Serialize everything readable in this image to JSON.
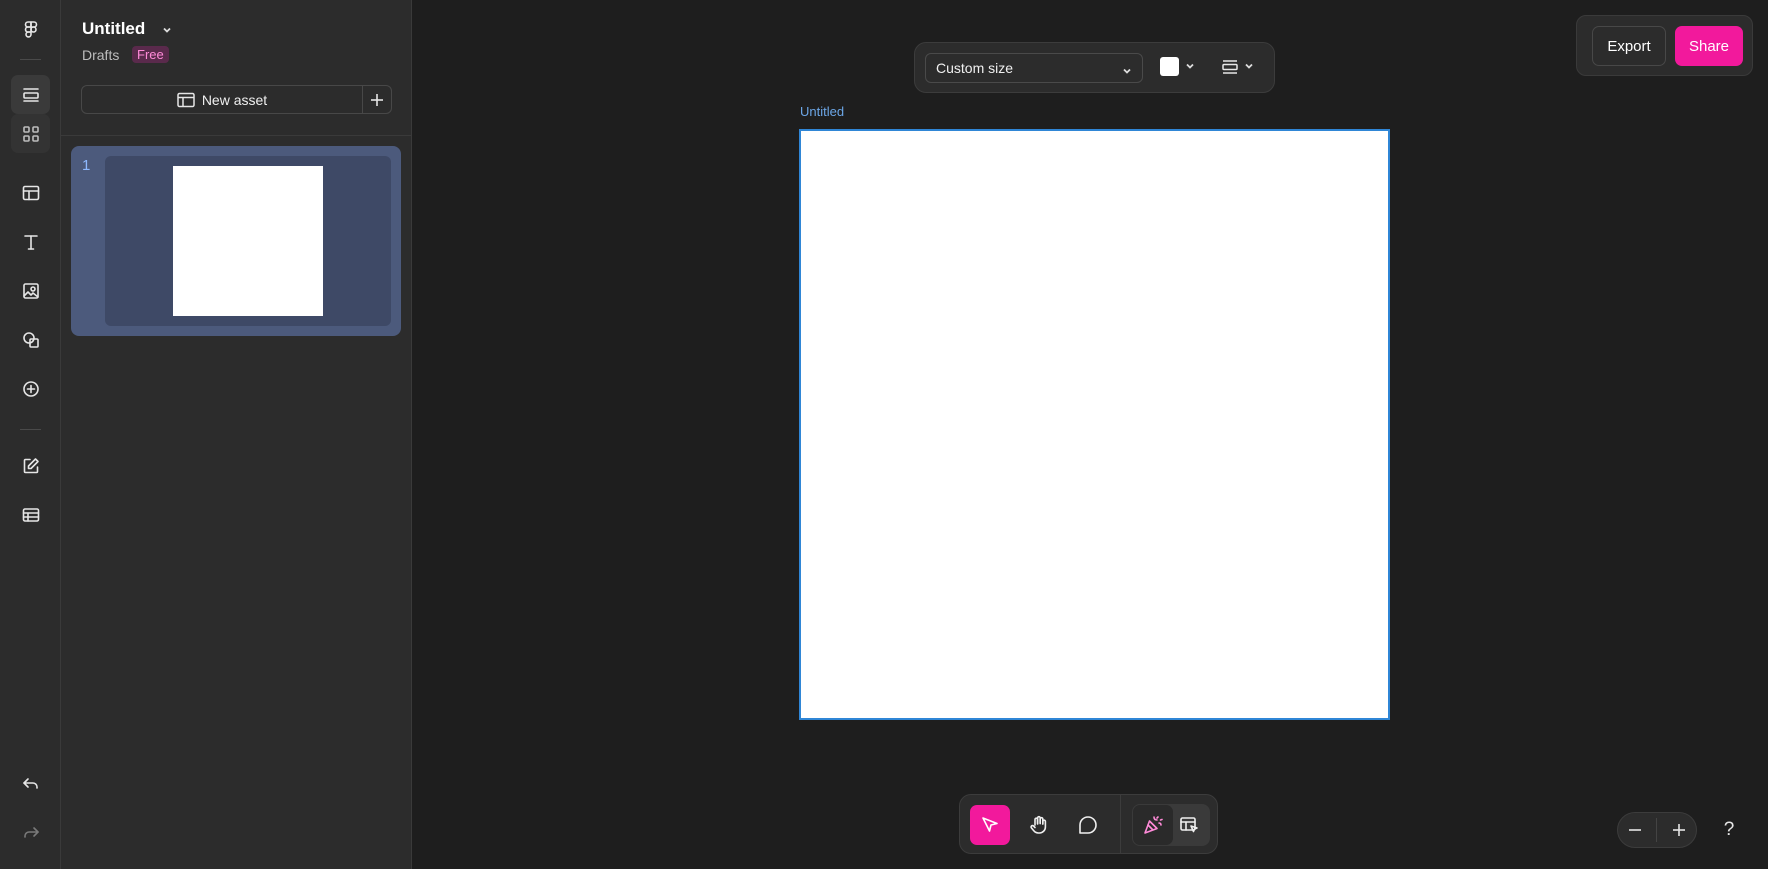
{
  "file": {
    "title": "Untitled",
    "location": "Drafts",
    "plan_badge": "Free"
  },
  "panel": {
    "new_asset_label": "New asset",
    "pages": [
      {
        "number": "1"
      }
    ]
  },
  "canvas": {
    "frame_label": "Untitled",
    "frame_fill": "#ffffff",
    "frame_selection_color": "#2f86d6"
  },
  "top_toolbar": {
    "size_value": "Custom size",
    "background_color": "#ffffff"
  },
  "actions": {
    "export_label": "Export",
    "share_label": "Share",
    "accent": "#f2199c"
  },
  "rail": {
    "icons": [
      "figma-logo-icon",
      "layers-icon",
      "assets-grid-icon",
      "layout-icon",
      "text-icon",
      "image-icon",
      "shapes-icon",
      "plus-circle-icon",
      "edit-icon",
      "table-icon",
      "undo-icon",
      "redo-icon"
    ]
  },
  "tools": {
    "icons": [
      "move-cursor-icon",
      "hand-icon",
      "comment-icon",
      "celebrate-icon",
      "annotate-icon"
    ]
  },
  "help_label": "?"
}
